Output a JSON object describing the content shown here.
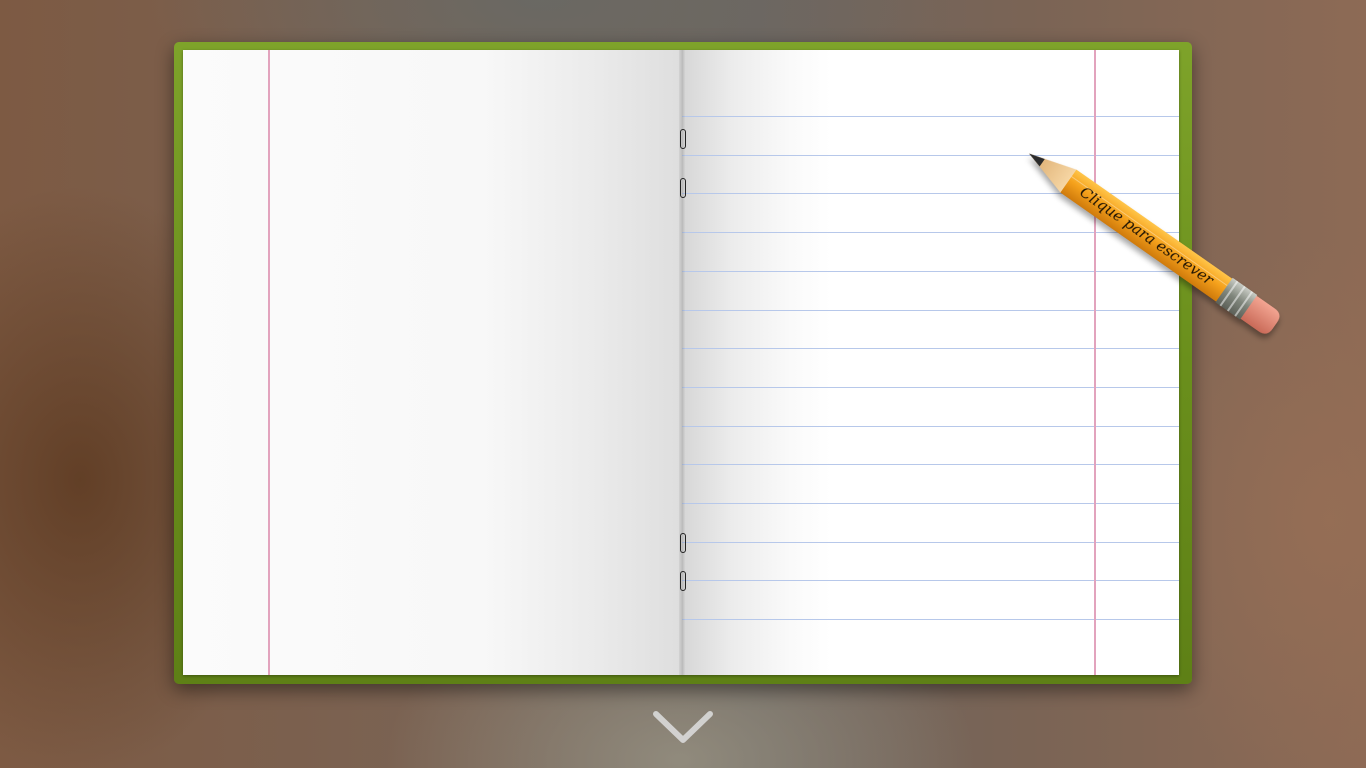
{
  "pencil": {
    "label": "Clique para escrever",
    "colors": {
      "body": "#f5a11c",
      "ferrule": "#8a8f86",
      "eraser": "#e38b78",
      "tip": "#2b2b2b"
    }
  },
  "notebook": {
    "cover_color": "#6f951f",
    "margin_line_color": "#e2a3bd",
    "rule_color": "#b7c8ea"
  },
  "navigation": {
    "scroll_down_icon": "chevron-down-icon"
  }
}
